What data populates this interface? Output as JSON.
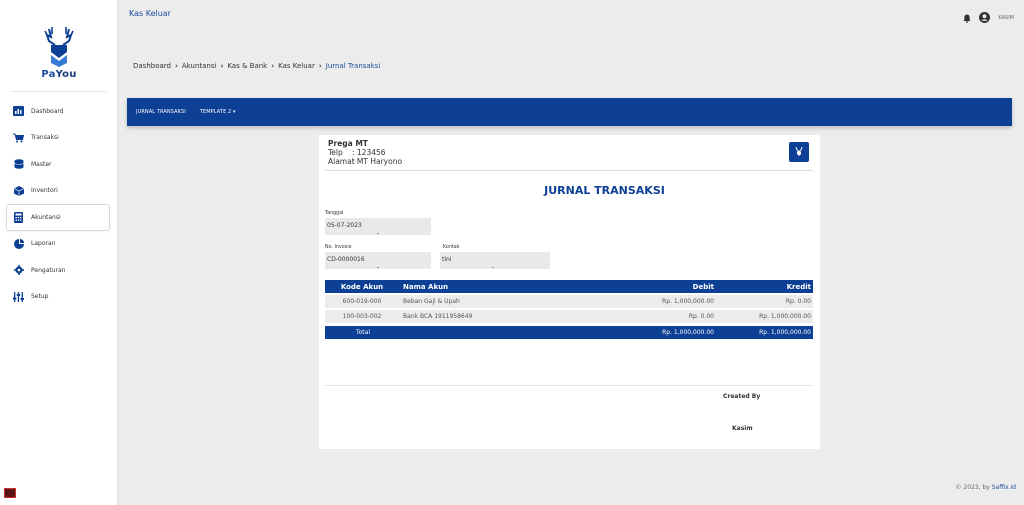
{
  "brand": {
    "name_part1": "Pa",
    "name_part2": "You",
    "accent": "#0d3f94"
  },
  "sidebar": {
    "items": [
      {
        "label": "Dashboard",
        "icon": "chart-icon"
      },
      {
        "label": "Transaksi",
        "icon": "cart-icon"
      },
      {
        "label": "Master",
        "icon": "database-icon"
      },
      {
        "label": "Inventori",
        "icon": "box-icon"
      },
      {
        "label": "Akuntansi",
        "icon": "calculator-icon",
        "active": true
      },
      {
        "label": "Laporan",
        "icon": "pie-icon"
      },
      {
        "label": "Pengaturan",
        "icon": "gear-icon"
      },
      {
        "label": "Setup",
        "icon": "sliders-icon"
      }
    ]
  },
  "header": {
    "title": "Kas Keluar",
    "user": "KASIM"
  },
  "breadcrumb": {
    "items": [
      "Dashboard",
      "Akuntansi",
      "Kas & Bank",
      "Kas Keluar"
    ],
    "current": "Jurnal Transaksi"
  },
  "toolbar": {
    "tab1": "JURNAL TRANSAKSI",
    "tab2": "TEMPLATE 2 ▾"
  },
  "document": {
    "company_name": "Prega MT",
    "telp_label": "Telp",
    "telp_value": ": 123456",
    "alamat_label": "Alamat",
    "alamat_value": ": MT Haryono",
    "title": "JURNAL TRANSAKSI",
    "tanggal_label": "Tanggal",
    "tanggal_value": "05-07-2023",
    "invoice_label": "No. Invoice",
    "invoice_value": "CD-0000016",
    "kontak_label": "Kontak",
    "kontak_value": "tini",
    "table": {
      "headers": [
        "Kode Akun",
        "Nama Akun",
        "Debit",
        "Kredit"
      ],
      "rows": [
        [
          "600-019-000",
          "Beban Gaji & Upah",
          "Rp. 1,000,000.00",
          "Rp. 0.00"
        ],
        [
          "100-003-002",
          "Bank BCA 1911958649",
          "Rp. 0.00",
          "Rp. 1,000,000.00"
        ]
      ],
      "total": [
        "Total",
        "",
        "Rp. 1,000,000.00",
        "Rp. 1,000,000.00"
      ]
    },
    "created_by_label": "Created By",
    "created_by_name": "Kasim"
  },
  "footer": {
    "text": "© 2023, by ",
    "link": "Saffix.id"
  }
}
